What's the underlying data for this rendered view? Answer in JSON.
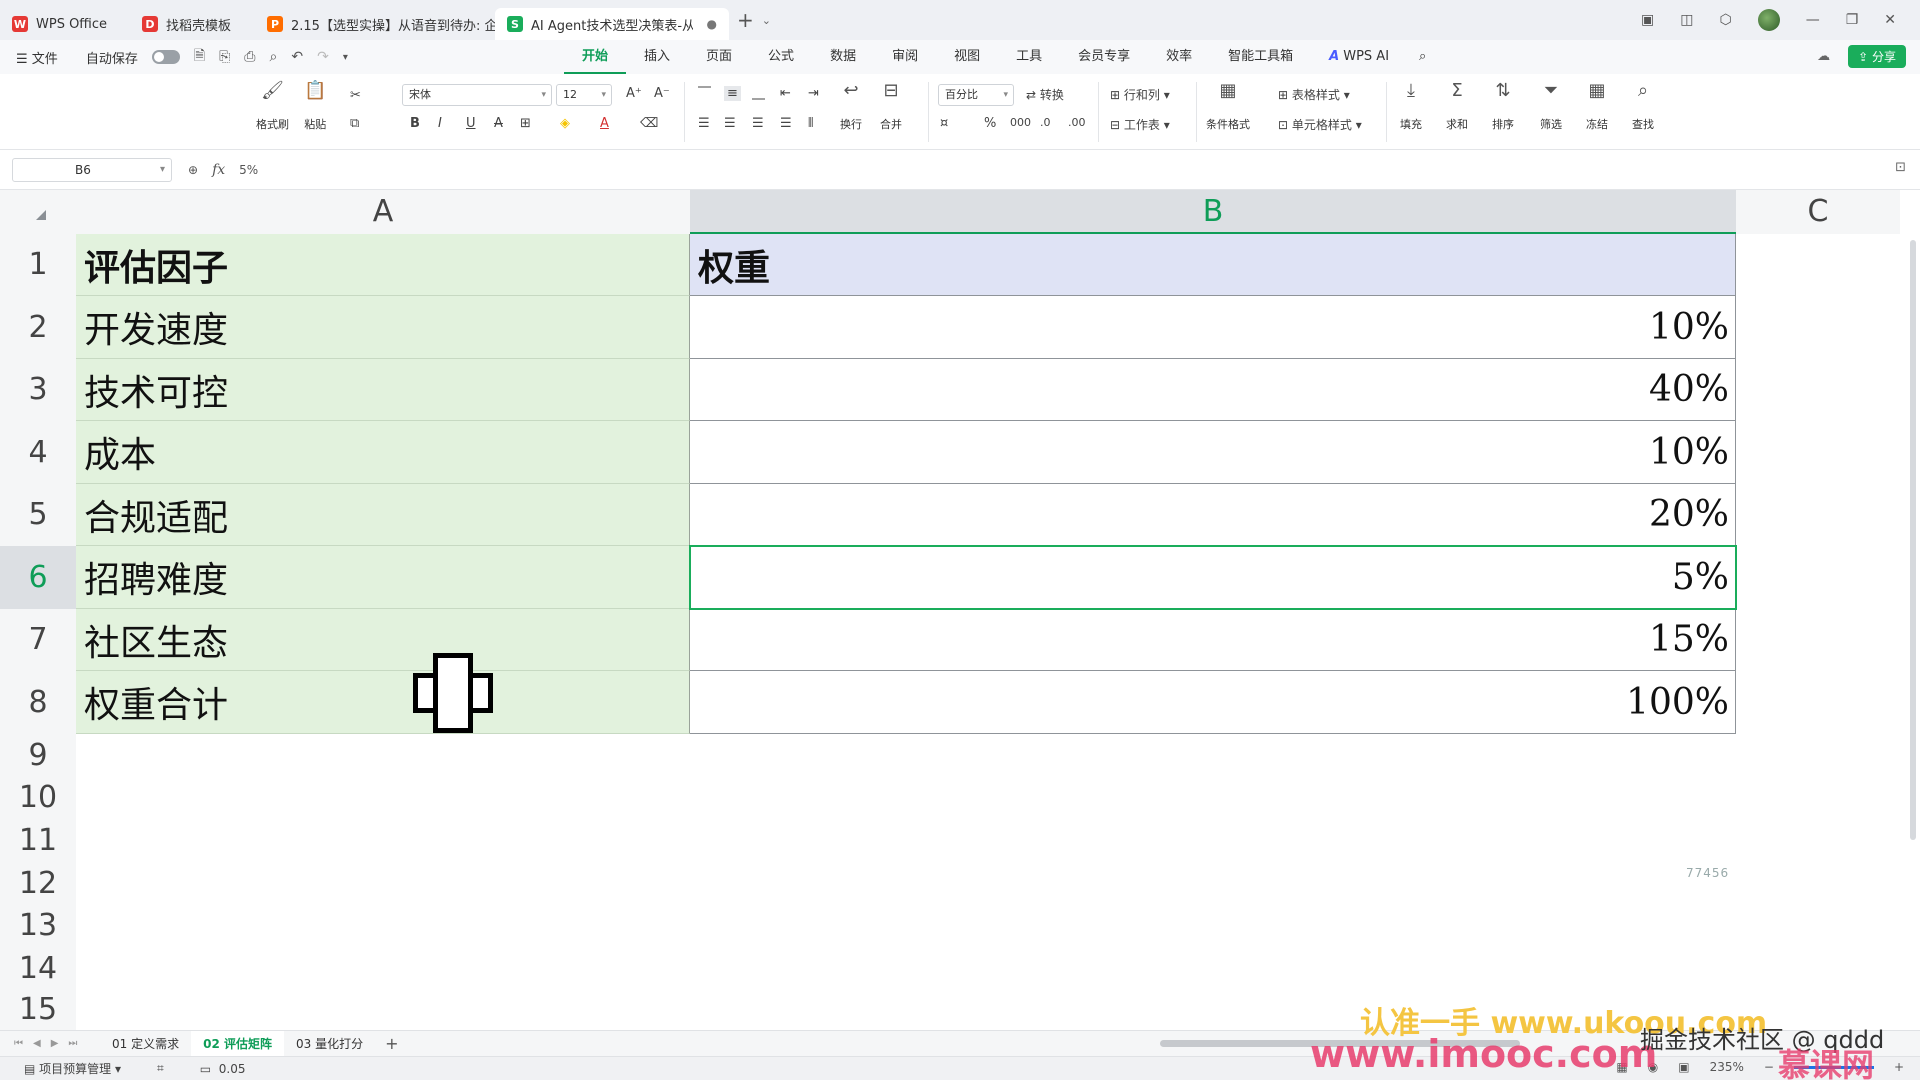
{
  "titlebar": {
    "tabs": [
      {
        "label": "WPS Office",
        "icon": "wps-logo-icon",
        "color": "#e53935"
      },
      {
        "label": "找稻壳模板",
        "icon": "docer-icon",
        "color": "#e53935"
      },
      {
        "label": "2.15【选型实操】从语音到待办: 企",
        "icon": "presentation-icon",
        "color": "#ff6d00"
      },
      {
        "label": "AI Agent技术选型决策表-从语言",
        "icon": "spreadsheet-icon",
        "color": "#1aad5b"
      }
    ],
    "add_label": "+",
    "dropdown_label": "⌄"
  },
  "menu": {
    "file_label": "文件",
    "autosave_label": "自动保存",
    "tabs": [
      "开始",
      "插入",
      "页面",
      "公式",
      "数据",
      "审阅",
      "视图",
      "工具",
      "会员专享",
      "效率",
      "智能工具箱"
    ],
    "active_tab": "开始",
    "wps_ai_label": "WPS AI",
    "share_label": "分享"
  },
  "ribbon": {
    "format_painter": "格式刷",
    "paste": "粘贴",
    "font_name": "宋体",
    "font_size": "12",
    "wrap": "换行",
    "merge": "合并",
    "number_format": "百分比",
    "convert": "转换",
    "rows_cols": "行和列",
    "worksheet": "工作表",
    "cond_format": "条件格式",
    "table_style": "表格样式",
    "cell_style": "单元格样式",
    "fill": "填充",
    "sum": "求和",
    "sort": "排序",
    "filter": "筛选",
    "freeze": "冻结",
    "find": "查找"
  },
  "formula_bar": {
    "cell_ref": "B6",
    "fx_label": "fx",
    "value": "5%"
  },
  "grid": {
    "columns": [
      "A",
      "B",
      "C"
    ],
    "selected_column": "B",
    "row_numbers": [
      "1",
      "2",
      "3",
      "4",
      "5",
      "6",
      "7",
      "8",
      "9",
      "10",
      "11",
      "12",
      "13",
      "14",
      "15"
    ],
    "selected_row": "6",
    "rows": [
      {
        "a": "评估因子",
        "b": "权重"
      },
      {
        "a": "开发速度",
        "b": "10%"
      },
      {
        "a": "技术可控",
        "b": "40%"
      },
      {
        "a": "成本",
        "b": "10%"
      },
      {
        "a": "合规适配",
        "b": "20%"
      },
      {
        "a": "招聘难度",
        "b": "5%"
      },
      {
        "a": "社区生态",
        "b": "15%"
      },
      {
        "a": "权重合计",
        "b": "100%"
      }
    ],
    "stray_text": "77456"
  },
  "sheets": {
    "tabs": [
      "01 定义需求",
      "02 评估矩阵",
      "03 量化打分"
    ],
    "active": "02 评估矩阵",
    "add_label": "+"
  },
  "status": {
    "project_label": "项目预算管理",
    "value": "0.05",
    "zoom": "235%"
  },
  "watermarks": {
    "line1": "认准一手 www.ukoou.com",
    "line2": "www.imooc.com",
    "line3": "掘金技术社区 @ qddd",
    "line4": "慕课网"
  },
  "colors": {
    "accent": "#0f9d58",
    "col_a_fill": "#e2f2dd",
    "header_b_fill": "#dfe3f5"
  }
}
